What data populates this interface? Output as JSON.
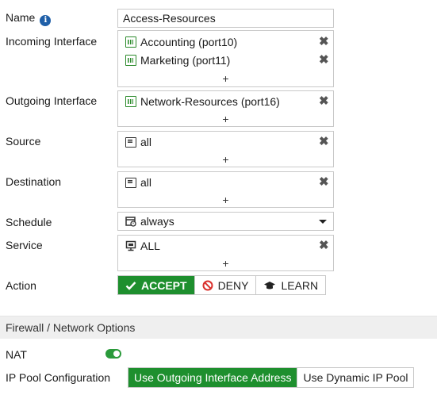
{
  "name": {
    "label": "Name",
    "value": "Access-Resources"
  },
  "incoming": {
    "label": "Incoming Interface",
    "items": [
      {
        "text": "Accounting (port10)",
        "icon": "network-interface-icon"
      },
      {
        "text": "Marketing (port11)",
        "icon": "network-interface-icon"
      }
    ],
    "add": "+"
  },
  "outgoing": {
    "label": "Outgoing Interface",
    "items": [
      {
        "text": "Network-Resources (port16)",
        "icon": "network-interface-icon"
      }
    ],
    "add": "+"
  },
  "source": {
    "label": "Source",
    "items": [
      {
        "text": "all",
        "icon": "address-icon"
      }
    ],
    "add": "+"
  },
  "destination": {
    "label": "Destination",
    "items": [
      {
        "text": "all",
        "icon": "address-icon"
      }
    ],
    "add": "+"
  },
  "schedule": {
    "label": "Schedule",
    "value": "always"
  },
  "service": {
    "label": "Service",
    "items": [
      {
        "text": "ALL",
        "icon": "service-icon"
      }
    ],
    "add": "+"
  },
  "action": {
    "label": "Action",
    "options": [
      {
        "label": "ACCEPT",
        "active": true
      },
      {
        "label": "DENY",
        "active": false
      },
      {
        "label": "LEARN",
        "active": false
      }
    ]
  },
  "section": {
    "title": "Firewall / Network Options"
  },
  "nat": {
    "label": "NAT",
    "enabled": true
  },
  "ip_pool": {
    "label": "IP Pool Configuration",
    "options": [
      {
        "label": "Use Outgoing Interface Address",
        "active": true
      },
      {
        "label": "Use Dynamic IP Pool",
        "active": false
      }
    ]
  },
  "colors": {
    "accent_green": "#1e8f2e",
    "info_blue": "#1f5fa8",
    "deny_red": "#d9302c"
  }
}
